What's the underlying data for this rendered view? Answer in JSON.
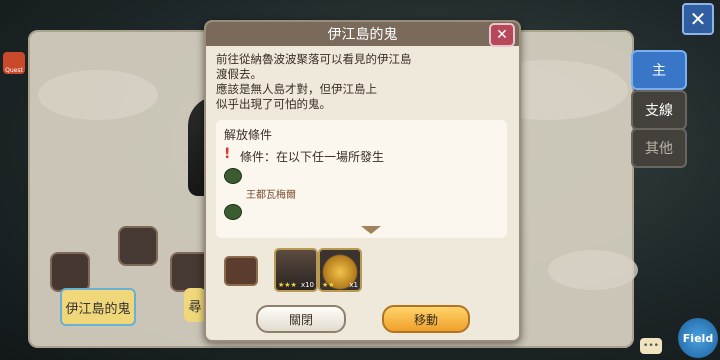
{
  "top_close": {
    "icon": "close-icon",
    "symbol": "✕"
  },
  "side_tabs": [
    {
      "label": "主"
    },
    {
      "label": "支線"
    },
    {
      "label": "其他"
    }
  ],
  "quest_icon": {
    "label": "Quest"
  },
  "stages": [
    {
      "label": "伊江島的鬼"
    },
    {
      "label": "尋"
    }
  ],
  "dialog": {
    "title": "伊江島的鬼",
    "close_symbol": "✕",
    "description": "前往從納魯波波聚落可以看見的伊江島\n渡假去。\n應該是無人島才對，但伊江島上\n似乎出現了可怕的鬼。",
    "conditions": {
      "title": "解放條件",
      "condition_text": "條件：在以下任一場所發生",
      "location": "王都瓦梅爾"
    },
    "rewards": [
      {
        "stars": "★★★",
        "count": "x10"
      },
      {
        "stars": "★★",
        "count": "x1"
      }
    ],
    "buttons": {
      "close": "關閉",
      "move": "移動"
    }
  },
  "field_button": {
    "label": "Field"
  }
}
